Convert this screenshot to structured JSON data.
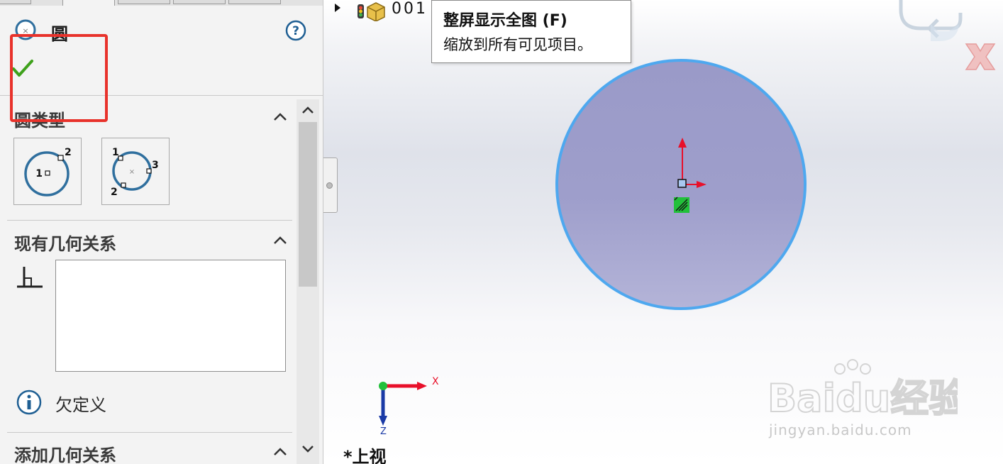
{
  "panel": {
    "title": "圆",
    "sections": {
      "circle_type": "圆类型",
      "existing_relations": "现有几何关系",
      "add_relations": "添加几何关系"
    },
    "circle_type_buttons": [
      {
        "labels": [
          "1",
          "2"
        ]
      },
      {
        "labels": [
          "1",
          "2",
          "3"
        ]
      }
    ],
    "status": "欠定义"
  },
  "graphics": {
    "part_name": "001",
    "tooltip": {
      "title": "整屏显示全图 (F)",
      "description": "缩放到所有可见项目。"
    },
    "triad": {
      "x_label": "X",
      "z_label": "Z"
    },
    "view_label": "*上视",
    "watermark": {
      "logo": "Baidu经验",
      "url": "jingyan.baidu.com"
    }
  },
  "colors": {
    "highlight_red": "#e8322b",
    "sketch_fill": "#a3a3cc",
    "sketch_edge": "#4ea8ef",
    "axis_red": "#e8102a",
    "axis_blue": "#1a3aa6",
    "axis_green": "#22c03a",
    "ok_green": "#3ea11b"
  }
}
